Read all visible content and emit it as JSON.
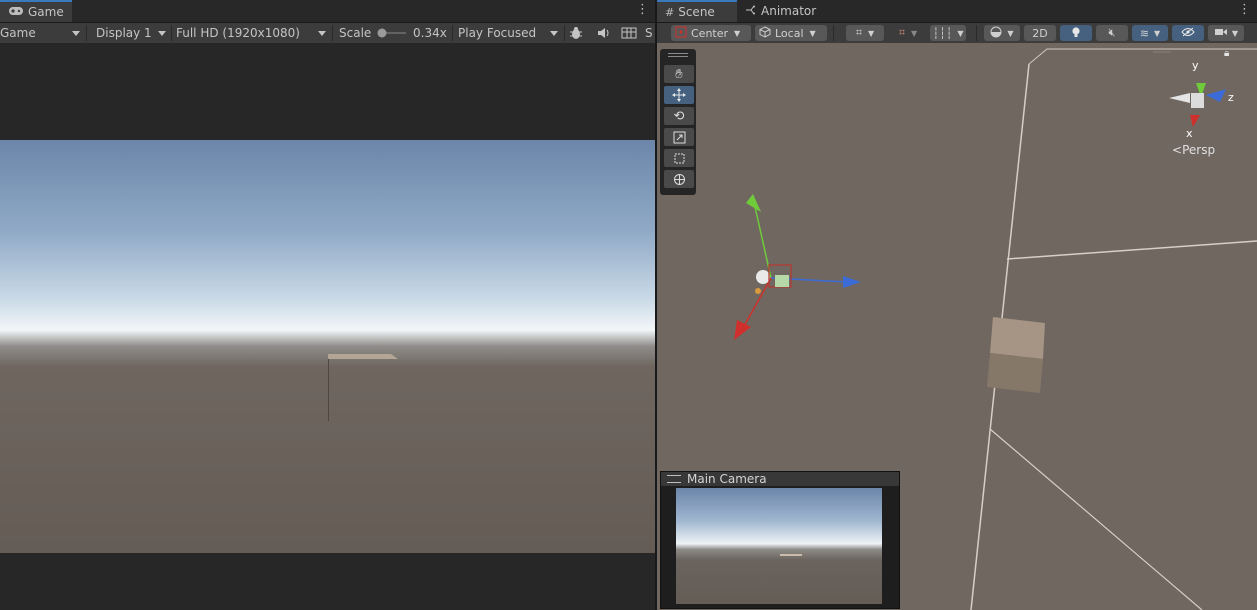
{
  "game": {
    "tab_title": "Game",
    "tab_icon": "gamepad-icon",
    "toolbar": {
      "mode": "Game",
      "display": "Display 1",
      "resolution": "Full HD (1920x1080)",
      "scale_label": "Scale",
      "scale_value": "0.34x",
      "play_mode": "Play Focused",
      "overflow_text": "S"
    }
  },
  "scene": {
    "tabs": [
      {
        "label": "Scene",
        "icon": "grid-icon",
        "active": true
      },
      {
        "label": "Animator",
        "icon": "animator-icon",
        "active": false
      }
    ],
    "toolbar": {
      "pivot": "Center",
      "space": "Local",
      "mode_2d": "2D"
    },
    "orientation": {
      "y": "y",
      "z": "z",
      "x": "x",
      "projection": "Persp"
    },
    "camera_preview_title": "Main Camera"
  },
  "colors": {
    "accent_blue": "#46607f",
    "tab_highlight": "#3a79bb",
    "scene_ground": "#716761",
    "gizmo_x": "#d0302b",
    "gizmo_y": "#6fcb3a",
    "gizmo_z": "#3a6bd6"
  }
}
